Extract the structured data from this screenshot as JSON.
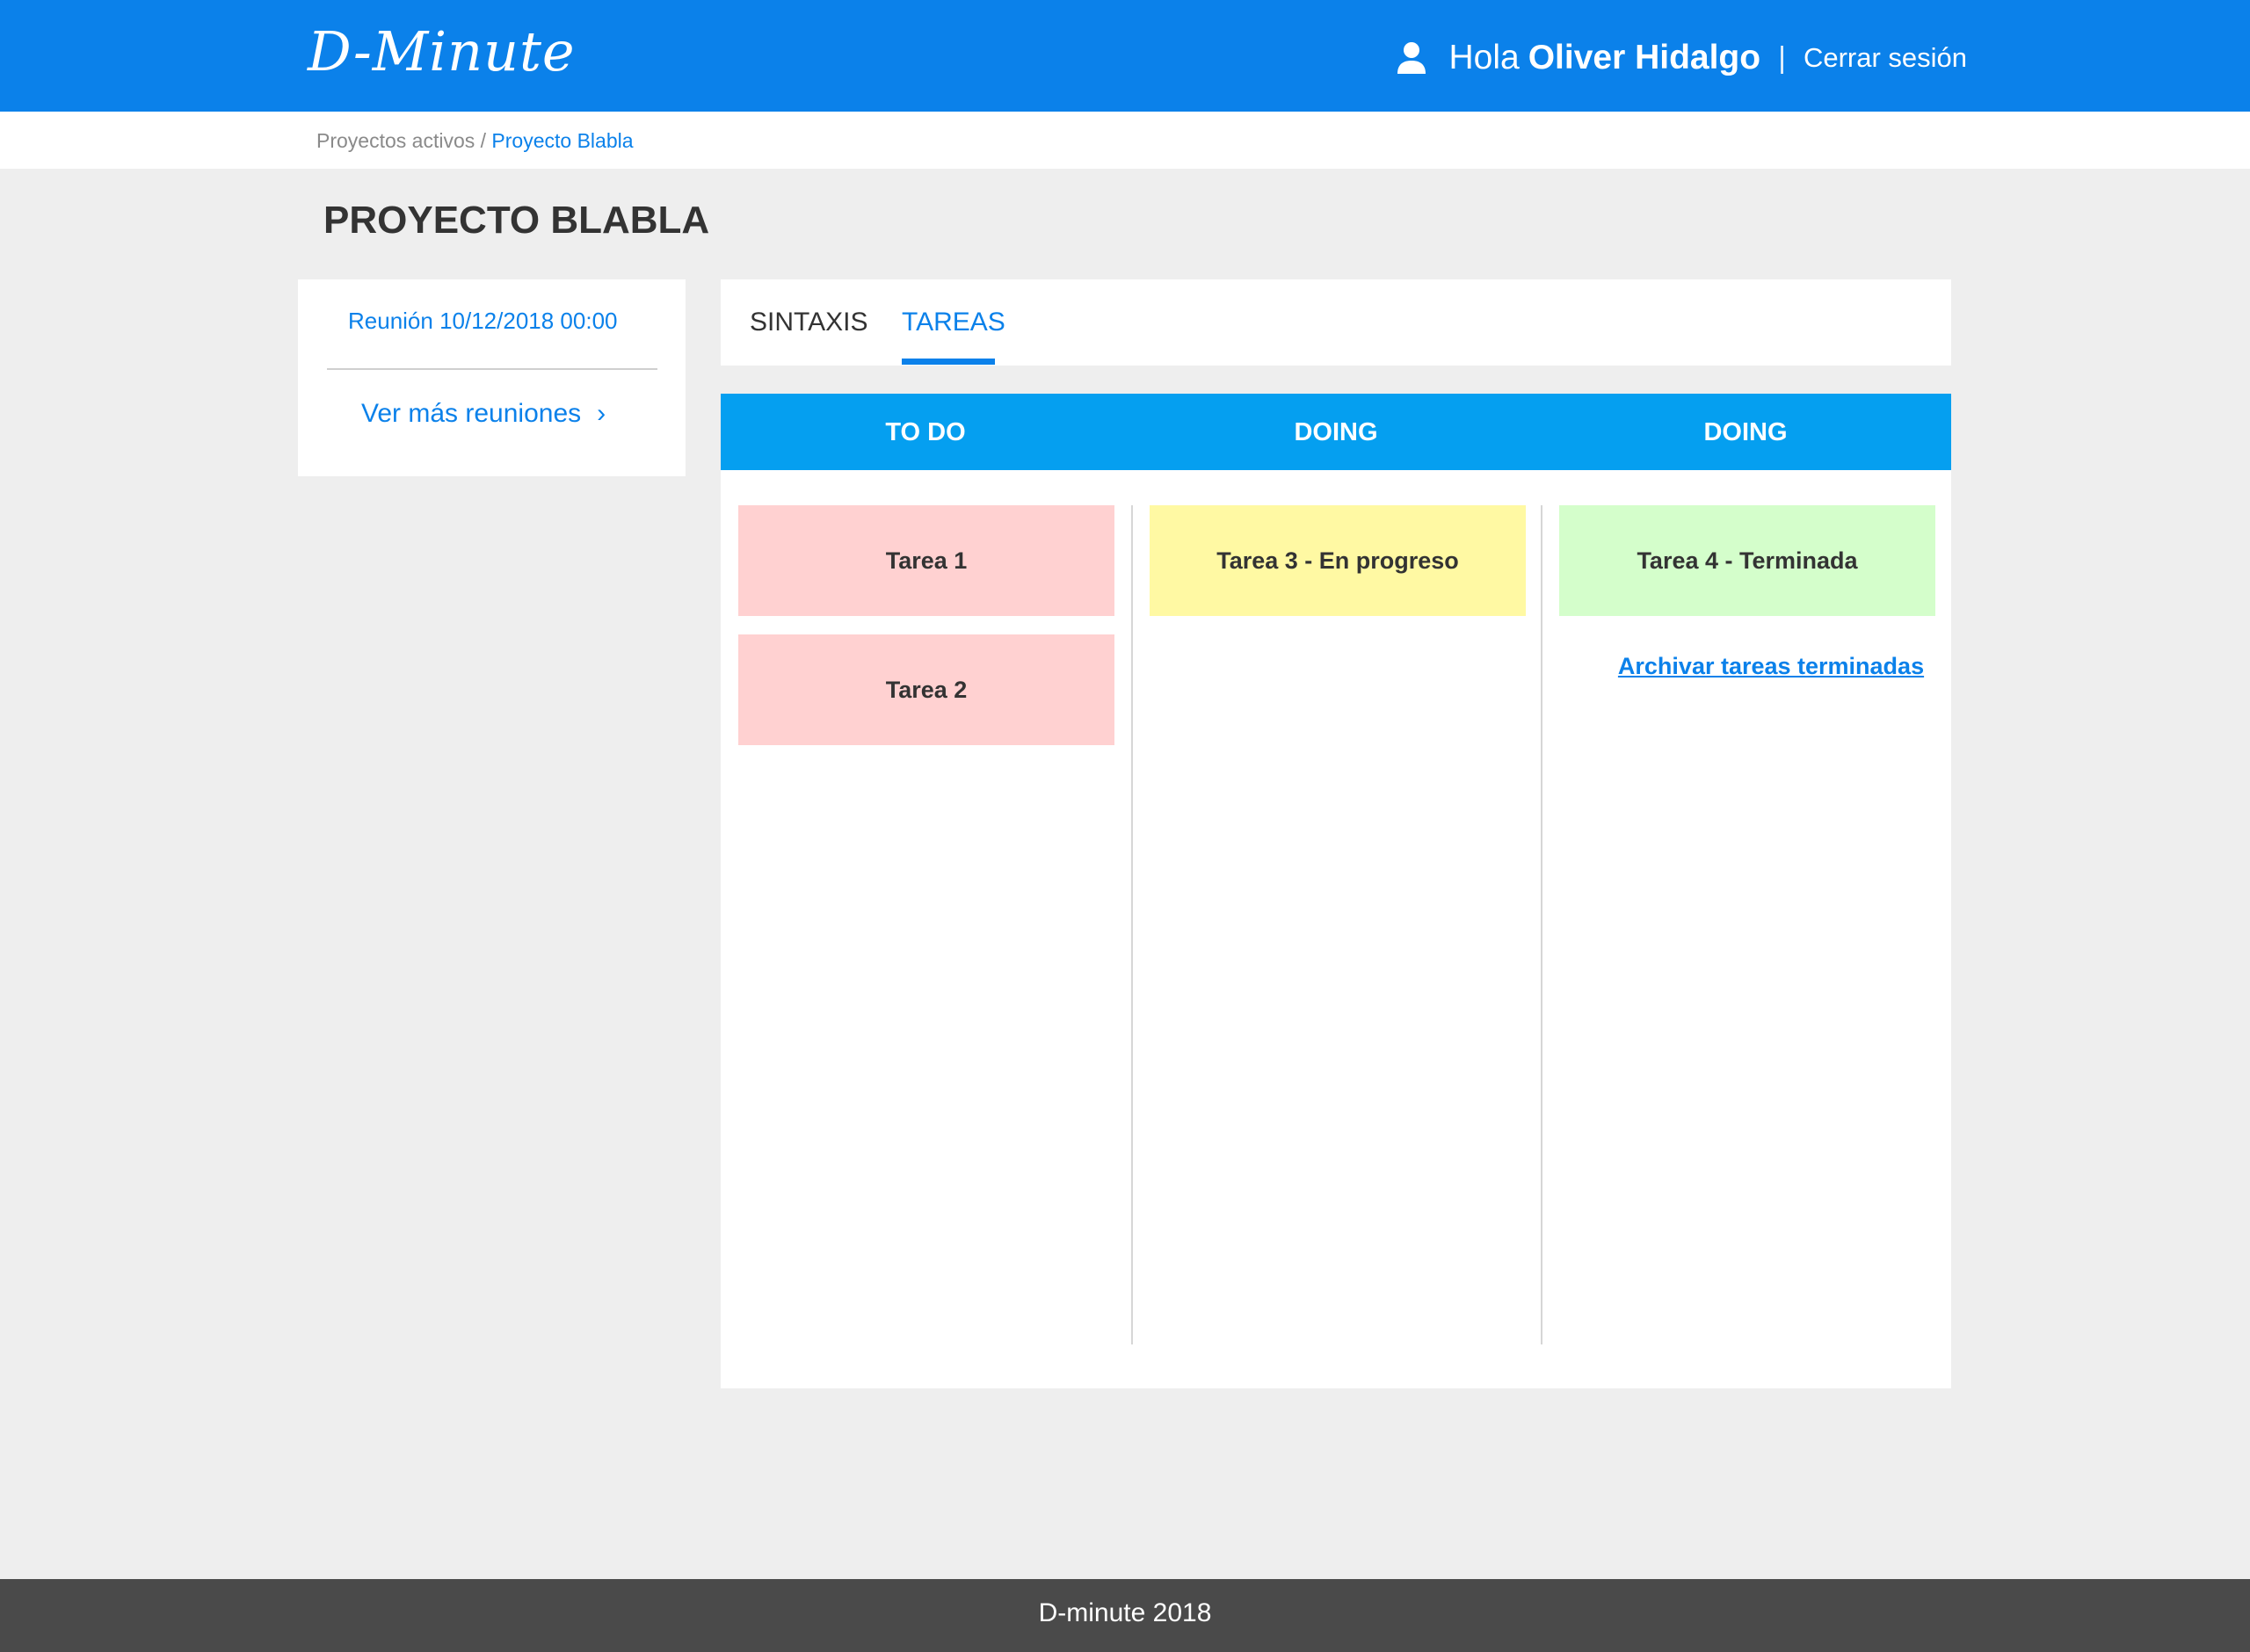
{
  "header": {
    "logo": "D-Minute",
    "greeting": "Hola",
    "user_name": "Oliver Hidalgo",
    "separator": "|",
    "logout_label": "Cerrar sesión",
    "user_icon": "user-icon"
  },
  "breadcrumb": {
    "parent": "Proyectos activos",
    "separator": "/",
    "current": "Proyecto Blabla"
  },
  "page": {
    "title": "PROYECTO BLABLA"
  },
  "meetings": {
    "latest": "Reunión 10/12/2018 00:00",
    "more_label": "Ver más reuniones",
    "more_icon": "chevron-right-icon",
    "chevron": "›"
  },
  "tabs": [
    {
      "label": "SINTAXIS",
      "active": false
    },
    {
      "label": "TAREAS",
      "active": true
    }
  ],
  "board": {
    "columns": [
      {
        "title": "TO DO",
        "tasks": [
          "Tarea 1",
          "Tarea 2"
        ]
      },
      {
        "title": "DOING",
        "tasks": [
          "Tarea 3 - En progreso"
        ]
      },
      {
        "title": "DOING",
        "tasks": [
          "Tarea 4 - Terminada"
        ]
      }
    ],
    "archive_label": "Archivar tareas terminadas"
  },
  "colors": {
    "brand_blue": "#0b81ea",
    "board_header": "#059ff0",
    "todo_card": "#ffd1d1",
    "doing_card": "#fff9a3",
    "done_card": "#d4fecb",
    "footer": "#4a4a4a",
    "background": "#eeeeee"
  },
  "footer": {
    "text": "D-minute 2018"
  }
}
